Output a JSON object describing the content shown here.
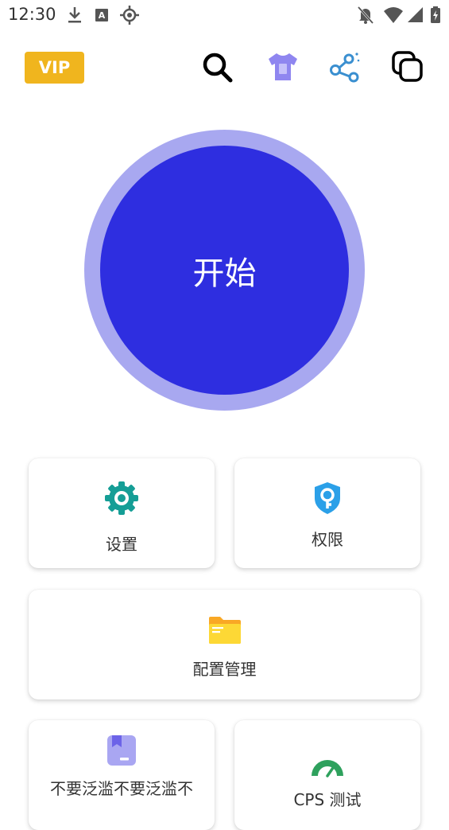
{
  "status_bar": {
    "time": "12:30",
    "left_icons": [
      "download-icon",
      "font-icon",
      "gps-icon"
    ],
    "right_icons": [
      "notifications-off-icon",
      "wifi-icon",
      "cellular-signal-icon",
      "battery-charging-icon"
    ]
  },
  "toolbar": {
    "vip_label": "VIP",
    "vip_color": "#F0B51E",
    "icons": [
      "search-icon",
      "theme-tshirt-icon",
      "share-icon",
      "copy-icon"
    ]
  },
  "start_button": {
    "label": "开始",
    "color": "#2E2EE0",
    "ring_color": "#A8A8F0"
  },
  "cards": {
    "settings": {
      "label": "设置",
      "icon": "gear-icon",
      "icon_color": "#159E96"
    },
    "permissions": {
      "label": "权限",
      "icon": "key-shield-icon",
      "icon_color": "#2BA0E8"
    },
    "config_manager": {
      "label": "配置管理",
      "icon": "folder-icon",
      "icon_color": "#FBC02D"
    },
    "partial_left": {
      "label": "不要泛滥不要泛滥不",
      "icon": "bookmark-icon",
      "icon_color": "#A9A6F2"
    },
    "cps_test": {
      "label": "CPS 测试",
      "icon": "speedometer-icon",
      "icon_color": "#2EA15D"
    }
  }
}
